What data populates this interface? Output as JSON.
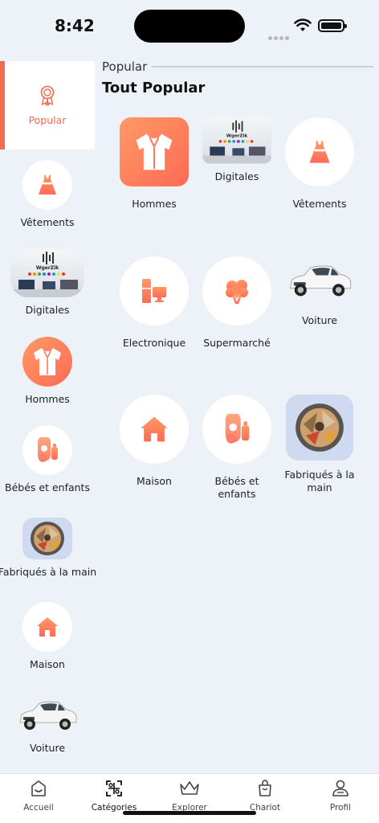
{
  "status": {
    "time": "8:42"
  },
  "sidebar": {
    "items": [
      {
        "label": "Popular",
        "icon": "award-icon",
        "active": true
      },
      {
        "label": "Vêtements",
        "icon": "dress-icon"
      },
      {
        "label": "Digitales",
        "icon": "digital-photo"
      },
      {
        "label": "Hommes",
        "icon": "shirt-icon"
      },
      {
        "label": "Bébés et enfants",
        "icon": "baby-icon"
      },
      {
        "label": "Fabriqués à la main",
        "icon": "handmade-photo"
      },
      {
        "label": "Maison",
        "icon": "house-icon"
      },
      {
        "label": "Voiture",
        "icon": "car-photo"
      }
    ]
  },
  "main": {
    "section_label": "Popular",
    "heading": "Tout Popular",
    "items": [
      {
        "label": "Hommes",
        "icon": "shirt-icon"
      },
      {
        "label": "Digitales",
        "icon": "digital-photo"
      },
      {
        "label": "Vêtements",
        "icon": "dress-icon"
      },
      {
        "label": "Electronique",
        "icon": "electronics-icon"
      },
      {
        "label": "Supermarché",
        "icon": "grocery-icon"
      },
      {
        "label": "Voiture",
        "icon": "car-photo"
      },
      {
        "label": "Maison",
        "icon": "house-icon"
      },
      {
        "label": "Bébés et enfants",
        "icon": "baby-icon"
      },
      {
        "label": "Fabriqués à la main",
        "icon": "handmade-photo"
      }
    ]
  },
  "photo_text": {
    "brand": "WgerZik"
  },
  "nav": {
    "items": [
      {
        "label": "Accueil",
        "icon": "home-icon"
      },
      {
        "label": "Catégories",
        "icon": "categories-icon",
        "active": true
      },
      {
        "label": "Explorer",
        "icon": "crown-icon"
      },
      {
        "label": "Chariot",
        "icon": "bag-icon"
      },
      {
        "label": "Profil",
        "icon": "profile-icon"
      }
    ]
  },
  "colors": {
    "accent": "#f26b4f",
    "background": "#edf1f8",
    "orange_gradient_start": "#ff9a66",
    "orange_gradient_end": "#ff6a55"
  }
}
